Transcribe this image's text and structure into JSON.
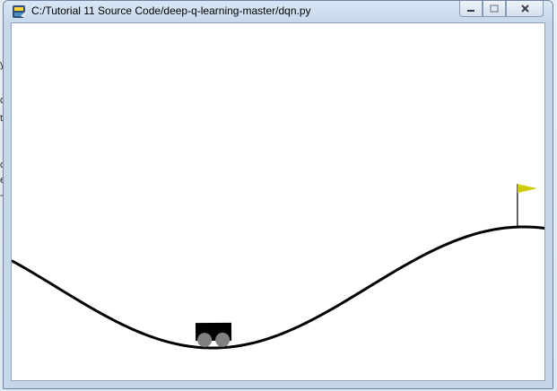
{
  "window": {
    "title": "C:/Tutorial 11 Source Code/deep-q-learning-master/dqn.py",
    "controls": {
      "minimize_icon": "minimize-icon",
      "maximize_icon": "maximize-icon",
      "close_icon": "close-icon"
    },
    "app_icon": "python-tk-icon"
  },
  "scene": {
    "environment": "MountainCar",
    "colors": {
      "background": "#ffffff",
      "track": "#000000",
      "car_body": "#000000",
      "wheels": "#808080",
      "flag": "#cccc00",
      "flagpole": "#000000"
    },
    "min_position": -1.2,
    "max_position": 0.6,
    "goal_position": 0.5,
    "car_position": -0.52
  },
  "backdrop": {
    "fragments": [
      "y",
      "d",
      "ts",
      "c",
      "e",
      "-"
    ]
  }
}
